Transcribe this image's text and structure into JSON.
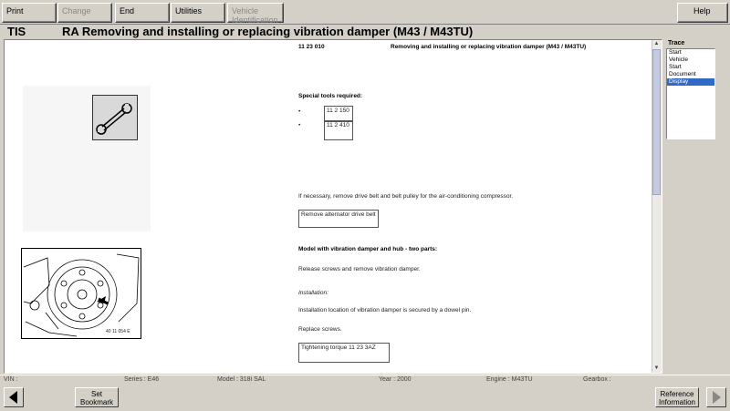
{
  "toolbar": {
    "print": "Print",
    "change": "Change",
    "end": "End",
    "utilities": "Utilities",
    "vehicle_identification": "Vehicle Identification",
    "help": "Help"
  },
  "header": {
    "app": "TIS",
    "title": "RA  Removing and installing or replacing vibration damper (M43 / M43TU)"
  },
  "document": {
    "number": "11 23 010",
    "heading": "Removing and installing or replacing vibration damper (M43 / M43TU)",
    "special_tools_label": "Special tools required:",
    "tools": [
      "11 2 150",
      "11 2 410"
    ],
    "step1": "If necessary, remove drive belt and belt pulley for the air-conditioning compressor.",
    "link1": "Remove alternator drive belt",
    "model_heading": "Model with vibration damper and hub - two parts:",
    "step2": "Release screws and remove vibration damper.",
    "installation_label": "Installation:",
    "step3": "Installation location of vibration damper is secured by a dowel pin.",
    "step4": "Replace screws.",
    "link2": "Tightening torque 11 23 3AZ",
    "figure_caption": "40 11 054 E"
  },
  "trace": {
    "label": "Trace",
    "items": [
      "Start",
      "Vehicle",
      "Start",
      "Document",
      "Display"
    ],
    "selected_index": 4
  },
  "status": {
    "vin": "VIN :",
    "series": "Series : E46",
    "model": "Model : 318i SAL",
    "year": "Year : 2000",
    "engine": "Engine : M43TU",
    "gearbox": "Gearbox :"
  },
  "bottom": {
    "set_bookmark": "Set Bookmark",
    "reference_information": "Reference Information"
  },
  "colors": {
    "chrome": "#d4d0c8",
    "selection": "#316ac5",
    "scroll_thumb": "#c4cbe0"
  }
}
